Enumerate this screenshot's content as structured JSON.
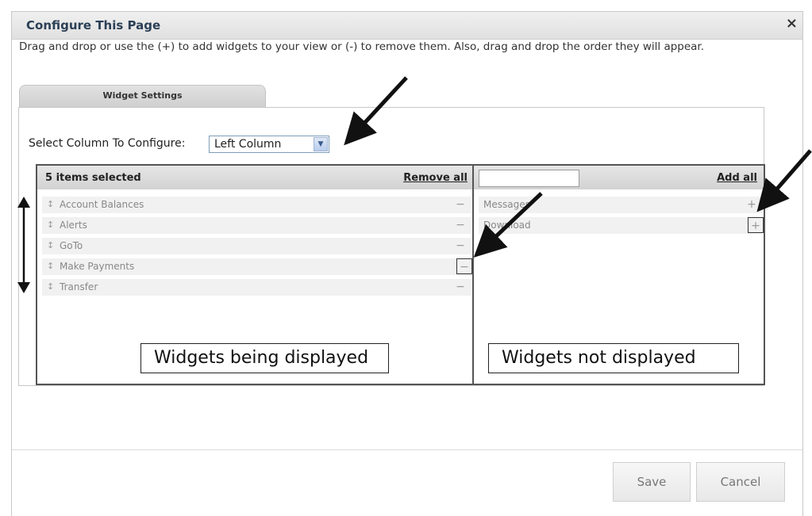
{
  "dialog": {
    "title": "Configure This Page",
    "close_icon": "close-icon",
    "close_glyph": "×",
    "instructions": "Drag and drop or use the (+) to add widgets to your view or (-) to remove them. Also, drag and drop the order they will appear."
  },
  "tab": {
    "label": "Widget Settings"
  },
  "column_select": {
    "label": "Select Column To Configure:",
    "selected_value": "Left Column"
  },
  "selected_list": {
    "count_label": "5 items selected",
    "remove_all_label": "Remove all",
    "items": [
      {
        "label": "Account Balances",
        "action": "−"
      },
      {
        "label": "Alerts",
        "action": "−"
      },
      {
        "label": "GoTo",
        "action": "−"
      },
      {
        "label": "Make Payments",
        "action": "−"
      },
      {
        "label": "Transfer",
        "action": "−"
      }
    ]
  },
  "available_list": {
    "search_placeholder": "",
    "add_all_label": "Add all",
    "items": [
      {
        "label": "Messages",
        "action": "+"
      },
      {
        "label": "Download",
        "action": "+"
      }
    ]
  },
  "annotations": {
    "displayed": "Widgets being displayed",
    "not_displayed": "Widgets not displayed"
  },
  "footer": {
    "save_label": "Save",
    "cancel_label": "Cancel"
  },
  "icons": {
    "drag_handle": "drag-handle-icon",
    "dropdown": "chevron-down-icon"
  }
}
